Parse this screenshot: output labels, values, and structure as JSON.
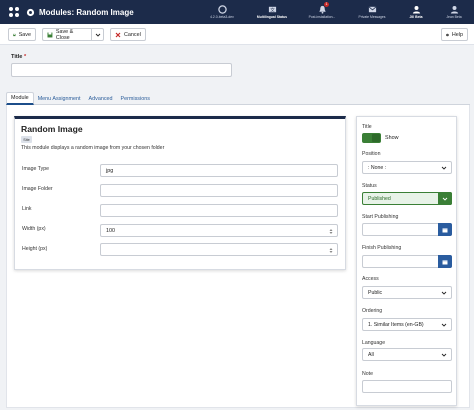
{
  "header": {
    "page_title": "Modules: Random Image",
    "tools": [
      {
        "label": "4.2.0-beta3-dev",
        "icon": "joomla-icon"
      },
      {
        "label": "Multilingual Status",
        "icon": "language-icon"
      },
      {
        "label": "Post-installation...",
        "icon": "bell-icon",
        "badge": "1"
      },
      {
        "label": "Private Messages",
        "icon": "envelope-icon"
      },
      {
        "label": "Jill Beta",
        "icon": "user-icon"
      },
      {
        "label": "Jean Beta",
        "icon": "user-icon"
      }
    ]
  },
  "toolbar": {
    "save_label": "Save",
    "save_close_label": "Save & Close",
    "cancel_label": "Cancel",
    "help_label": "Help"
  },
  "title_field": {
    "label": "Title",
    "required_mark": "*",
    "value": ""
  },
  "tabs": [
    "Module",
    "Menu Assignment",
    "Advanced",
    "Permissions"
  ],
  "card": {
    "title": "Random Image",
    "badge": "Site",
    "description": "This module displays a random image from your chosen folder",
    "fields": [
      {
        "label": "Image Type",
        "value": "jpg"
      },
      {
        "label": "Image Folder",
        "value": ""
      },
      {
        "label": "Link",
        "value": ""
      },
      {
        "label": "Width (px)",
        "value": "100"
      },
      {
        "label": "Height (px)",
        "value": ""
      }
    ]
  },
  "sidebar": {
    "title_label": "Title",
    "show_label": "Show",
    "position_label": "Position",
    "position_value": ": None :",
    "status_label": "Status",
    "status_value": "Published",
    "start_publishing_label": "Start Publishing",
    "finish_publishing_label": "Finish Publishing",
    "access_label": "Access",
    "access_value": "Public",
    "ordering_label": "Ordering",
    "ordering_value": "1. Similar Items (en-GB)",
    "language_label": "Language",
    "language_value": "All",
    "note_label": "Note"
  },
  "colors": {
    "header_bg": "#1c2b4a",
    "status_green": "#3a7f36",
    "calendar_blue": "#2a5c9f",
    "required_red": "#c52827"
  }
}
